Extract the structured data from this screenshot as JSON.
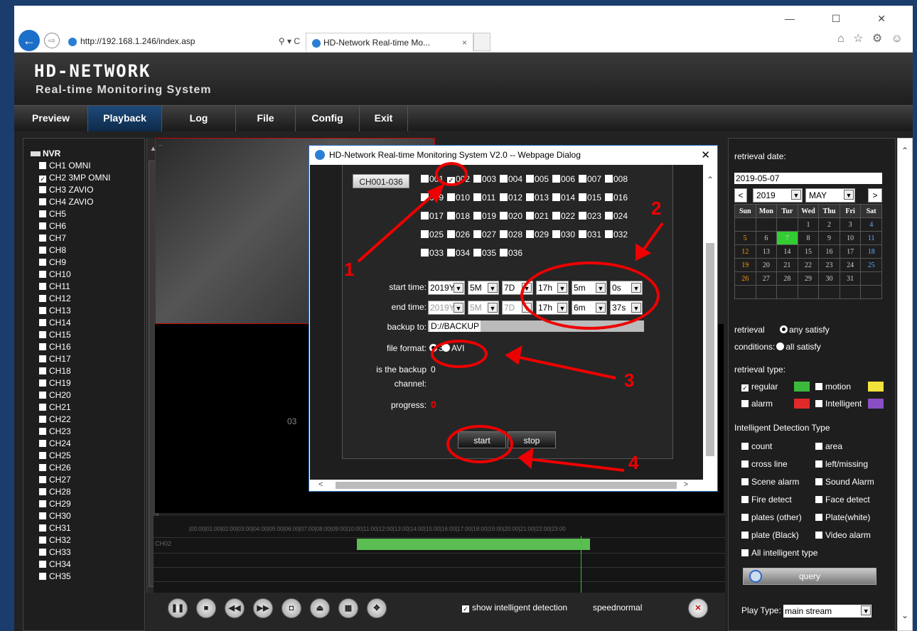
{
  "browser": {
    "url": "http://192.168.1.246/index.asp",
    "search_ctrl": "⚲ ▾ C",
    "tab_title": "HD-Network Real-time Mo...",
    "tab_close": "×",
    "win_controls": "— ☐ ✕",
    "fav_icons": "⌂ ☆ ⚙ ☺",
    "back_icon": "←",
    "fwd_icon": "⇨"
  },
  "header": {
    "logo_line1": "HD-NETWORK",
    "logo_line2": "Real-time Monitoring System"
  },
  "nav": [
    "Preview",
    "Playback",
    "Log",
    "File",
    "Config",
    "Exit"
  ],
  "device_tree": {
    "root": "NVR",
    "channels": [
      {
        "label": "CH1 OMNI",
        "checked": false
      },
      {
        "label": "CH2 3MP OMNI",
        "checked": true
      },
      {
        "label": "CH3 ZAVIO",
        "checked": false
      },
      {
        "label": "CH4 ZAVIO",
        "checked": false
      },
      {
        "label": "CH5",
        "checked": false
      },
      {
        "label": "CH6",
        "checked": false
      },
      {
        "label": "CH7",
        "checked": false
      },
      {
        "label": "CH8",
        "checked": false
      },
      {
        "label": "CH9",
        "checked": false
      },
      {
        "label": "CH10",
        "checked": false
      },
      {
        "label": "CH11",
        "checked": false
      },
      {
        "label": "CH12",
        "checked": false
      },
      {
        "label": "CH13",
        "checked": false
      },
      {
        "label": "CH14",
        "checked": false
      },
      {
        "label": "CH15",
        "checked": false
      },
      {
        "label": "CH16",
        "checked": false
      },
      {
        "label": "CH17",
        "checked": false
      },
      {
        "label": "CH18",
        "checked": false
      },
      {
        "label": "CH19",
        "checked": false
      },
      {
        "label": "CH20",
        "checked": false
      },
      {
        "label": "CH21",
        "checked": false
      },
      {
        "label": "CH22",
        "checked": false
      },
      {
        "label": "CH23",
        "checked": false
      },
      {
        "label": "CH24",
        "checked": false
      },
      {
        "label": "CH25",
        "checked": false
      },
      {
        "label": "CH26",
        "checked": false
      },
      {
        "label": "CH27",
        "checked": false
      },
      {
        "label": "CH28",
        "checked": false
      },
      {
        "label": "CH29",
        "checked": false
      },
      {
        "label": "CH30",
        "checked": false
      },
      {
        "label": "CH31",
        "checked": false
      },
      {
        "label": "CH32",
        "checked": false
      },
      {
        "label": "CH33",
        "checked": false
      },
      {
        "label": "CH34",
        "checked": false
      },
      {
        "label": "CH35",
        "checked": false
      }
    ]
  },
  "video": {
    "window_label": "03"
  },
  "timeline": {
    "hours": "|00:00|01:00|02:00|03:00|04:00|05:00|06:00|07:00|08:00|09:00|10:00|11:00|12:00|13:00|14:00|15:00|16:00|17:00|18:00|19:00|20:00|21:00|22:00|23:00",
    "channel": "CH02"
  },
  "playback_controls": {
    "show_intelligent": "show intelligent detection",
    "speed": "speednormal"
  },
  "retrieval": {
    "date_label": "retrieval date:",
    "date_value": "2019-05-07",
    "year": "2019",
    "month": "MAY",
    "prev": "<",
    "next": ">",
    "weekdays": [
      "Sun",
      "Mon",
      "Tur",
      "Wed",
      "Thu",
      "Fri",
      "Sat"
    ],
    "weeks": [
      [
        "",
        "",
        "",
        "1",
        "2",
        "3",
        "4"
      ],
      [
        "5",
        "6",
        "7",
        "8",
        "9",
        "10",
        "11"
      ],
      [
        "12",
        "13",
        "14",
        "15",
        "16",
        "17",
        "18"
      ],
      [
        "19",
        "20",
        "21",
        "22",
        "23",
        "24",
        "25"
      ],
      [
        "26",
        "27",
        "28",
        "29",
        "30",
        "31",
        ""
      ],
      [
        "",
        "",
        "",
        "",
        "",
        "",
        ""
      ]
    ],
    "conditions_label1": "retrieval",
    "conditions_label2": "conditions:",
    "any_satisfy": "any satisfy",
    "all_satisfy": "all satisfy",
    "type_label": "retrieval type:",
    "types": [
      {
        "label": "regular",
        "checked": true,
        "color": "#3cba3c"
      },
      {
        "label": "motion",
        "checked": false,
        "color": "#f2e23a"
      },
      {
        "label": "alarm",
        "checked": false,
        "color": "#e02a2a"
      },
      {
        "label": "Intelligent",
        "checked": false,
        "color": "#8a4fc4"
      }
    ],
    "intelligent_label": "Intelligent Detection Type",
    "intelligent_types": [
      "count",
      "area",
      "cross line",
      "left/missing",
      "Scene alarm",
      "Sound Alarm",
      "Fire detect",
      "Face detect",
      "plates (other)",
      "Plate(white)",
      "plate (Black)",
      "Video alarm"
    ],
    "all_intelligent": "All intelligent type",
    "query": "query",
    "play_type_label": "Play Type:",
    "play_type_value": "main stream"
  },
  "dialog": {
    "title": "HD-Network Real-time Monitoring System V2.0 -- Webpage Dialog",
    "close": "✕",
    "channel_group": "CH001-036",
    "channels": [
      "001",
      "002",
      "003",
      "004",
      "005",
      "006",
      "007",
      "008",
      "009",
      "010",
      "011",
      "012",
      "013",
      "014",
      "015",
      "016",
      "017",
      "018",
      "019",
      "020",
      "021",
      "022",
      "023",
      "024",
      "025",
      "026",
      "027",
      "028",
      "029",
      "030",
      "031",
      "032",
      "033",
      "034",
      "035",
      "036"
    ],
    "checked_channel": "002",
    "start_label": "start time:",
    "start": [
      "2019Y",
      "5M",
      "7D",
      "17h",
      "5m",
      "0s"
    ],
    "end_label": "end time:",
    "end": [
      "2019Y",
      "5M",
      "7D",
      "17h",
      "6m",
      "37s"
    ],
    "backup_label": "backup to:",
    "backup_path": "D://BACKUP",
    "format_label": "file format:",
    "format_opt1": "3",
    "format_opt2": "AVI",
    "backup_channel_label1": "is the backup",
    "backup_channel_label2": "channel:",
    "backup_channel_value": "0",
    "progress_label": "progress:",
    "progress_value": "0",
    "start_btn": "start",
    "stop_btn": "stop"
  },
  "annotations": [
    "1",
    "2",
    "3",
    "4"
  ]
}
